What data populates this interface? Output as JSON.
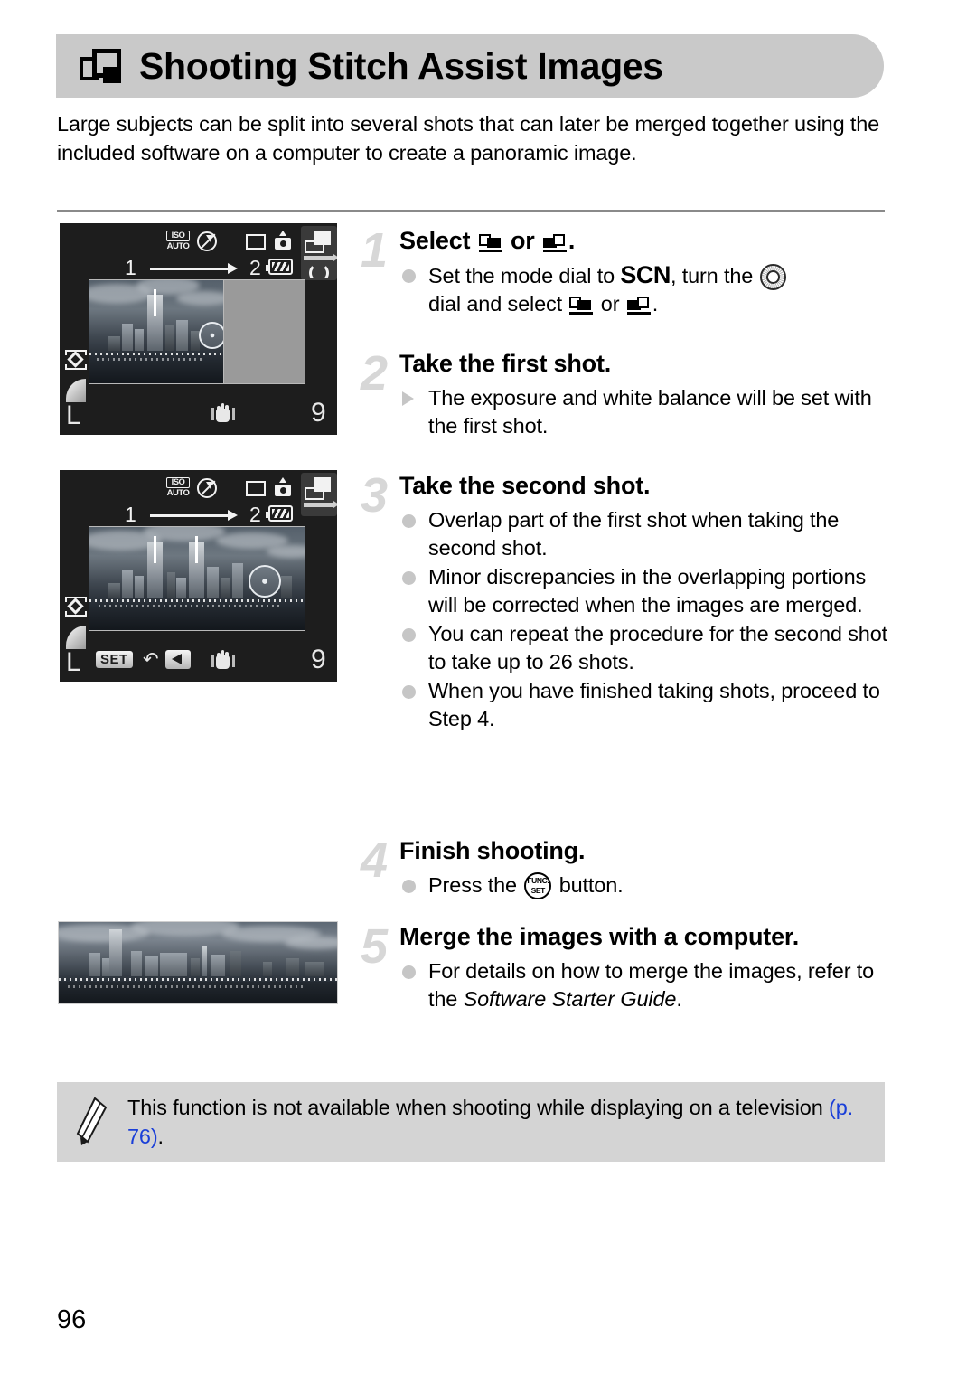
{
  "header": {
    "title": "Shooting Stitch Assist Images",
    "icon": "stitch-assist-icon"
  },
  "intro": "Large subjects can be split into several shots that can later be merged together using the included software on a computer to create a panoramic image.",
  "steps": [
    {
      "number": "1",
      "title_before": "Select",
      "title_mid": "or",
      "title_after": ".",
      "bullets": [
        {
          "marker": "dot",
          "t1": "Set the mode dial to",
          "scn": "SCN",
          "t2": ", turn the",
          "t3": "dial and select",
          "t4": "or",
          "t5": "."
        }
      ]
    },
    {
      "number": "2",
      "title": "Take the first shot.",
      "bullets": [
        {
          "marker": "triangle",
          "text": "The exposure and white balance will be set with the first shot."
        }
      ]
    },
    {
      "number": "3",
      "title": "Take the second shot.",
      "bullets": [
        {
          "marker": "dot",
          "text": "Overlap part of the first shot when taking the second shot."
        },
        {
          "marker": "dot",
          "text": "Minor discrepancies in the overlapping portions will be corrected when the images are merged."
        },
        {
          "marker": "dot",
          "text": "You can repeat the procedure for the second shot to take up to 26 shots."
        },
        {
          "marker": "dot",
          "text": "When you have finished taking shots, proceed to Step 4."
        }
      ]
    },
    {
      "number": "4",
      "title": "Finish shooting.",
      "bullets": [
        {
          "marker": "dot",
          "t1": "Press the",
          "func_line1": "FUNC.",
          "func_line2": "SET",
          "t2": "button."
        }
      ]
    },
    {
      "number": "5",
      "title": "Merge the images with a computer.",
      "bullets": [
        {
          "marker": "dot",
          "t1": "For details on how to merge the images, refer to the",
          "italic": "Software Starter Guide",
          "t2": "."
        }
      ]
    }
  ],
  "lcd_screens": [
    {
      "id": "lcd-1",
      "caption": "first shot framing screen",
      "iso_label_top": "ISO",
      "iso_label_bottom": "AUTO",
      "seq_from": "1",
      "seq_to": "2",
      "size": "L",
      "shots_remaining": "9",
      "icons": [
        "flash-off-icon",
        "af-frame-icon",
        "camera-up-icon",
        "stitch-mode-icon",
        "rotate-arrow-icon",
        "battery-icon",
        "metering-icon",
        "quality-icon",
        "shake-warning-icon"
      ]
    },
    {
      "id": "lcd-2",
      "caption": "second shot framing screen",
      "iso_label_top": "ISO",
      "iso_label_bottom": "AUTO",
      "seq_from": "1",
      "seq_to": "2",
      "size": "L",
      "shots_remaining": "9",
      "set_badge": "SET",
      "icons": [
        "flash-off-icon",
        "af-frame-icon",
        "camera-up-icon",
        "stitch-mode-icon",
        "battery-icon",
        "metering-icon",
        "quality-icon",
        "back-arrow-icon",
        "left-arrow-icon",
        "shake-warning-icon"
      ]
    }
  ],
  "panorama": {
    "caption": "merged panoramic cityscape result image"
  },
  "note": {
    "icon": "pencil-icon",
    "text_before": "This function is not available when shooting while displaying on a television ",
    "page_ref": "(p. 76)",
    "text_after": "."
  },
  "page_number": "96",
  "colors": {
    "banner_bg": "#c9c9c9",
    "note_bg": "#d4d4d4",
    "step_number": "#d7d7d7",
    "bullet_dot": "#c6c6c6",
    "page_ref_link": "#1a3fd8",
    "lcd_bg": "#1d1d1d"
  }
}
